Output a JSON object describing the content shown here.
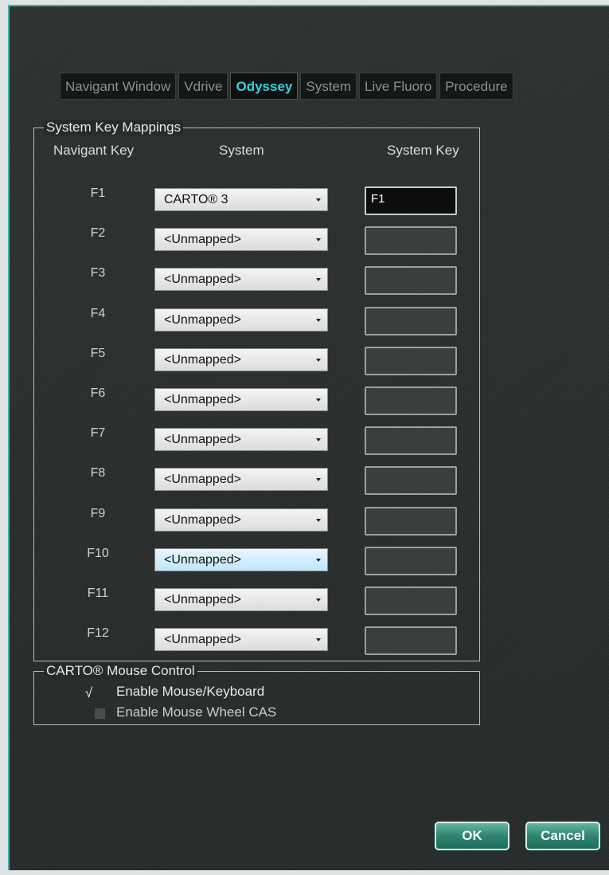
{
  "tabs": [
    {
      "label": "Navigant Window",
      "active": false
    },
    {
      "label": "Vdrive",
      "active": false
    },
    {
      "label": "Odyssey",
      "active": true
    },
    {
      "label": "System",
      "active": false
    },
    {
      "label": "Live Fluoro",
      "active": false
    },
    {
      "label": "Procedure",
      "active": false
    }
  ],
  "key_mappings": {
    "title": "System Key Mappings",
    "headers": {
      "navigant_key": "Navigant Key",
      "system": "System",
      "system_key": "System Key"
    },
    "rows": [
      {
        "key": "F1",
        "system": "CARTO® 3",
        "system_key": "F1"
      },
      {
        "key": "F2",
        "system": "<Unmapped>",
        "system_key": ""
      },
      {
        "key": "F3",
        "system": "<Unmapped>",
        "system_key": ""
      },
      {
        "key": "F4",
        "system": "<Unmapped>",
        "system_key": ""
      },
      {
        "key": "F5",
        "system": "<Unmapped>",
        "system_key": ""
      },
      {
        "key": "F6",
        "system": "<Unmapped>",
        "system_key": ""
      },
      {
        "key": "F7",
        "system": "<Unmapped>",
        "system_key": ""
      },
      {
        "key": "F8",
        "system": "<Unmapped>",
        "system_key": ""
      },
      {
        "key": "F9",
        "system": "<Unmapped>",
        "system_key": ""
      },
      {
        "key": "F10",
        "system": "<Unmapped>",
        "system_key": ""
      },
      {
        "key": "F11",
        "system": "<Unmapped>",
        "system_key": ""
      },
      {
        "key": "F12",
        "system": "<Unmapped>",
        "system_key": ""
      }
    ]
  },
  "mouse_control": {
    "title": "CARTO® Mouse Control",
    "enable_mouse_keyboard": {
      "label": "Enable Mouse/Keyboard",
      "checked": true,
      "check_glyph": "√"
    },
    "enable_mouse_wheel": {
      "label": "Enable Mouse Wheel CAS",
      "checked": false
    }
  },
  "buttons": {
    "ok": "OK",
    "cancel": "Cancel"
  },
  "colors": {
    "accent_border": "#3bb3b0",
    "active_tab_text": "#2fd4e0",
    "button": "#2f8472"
  }
}
